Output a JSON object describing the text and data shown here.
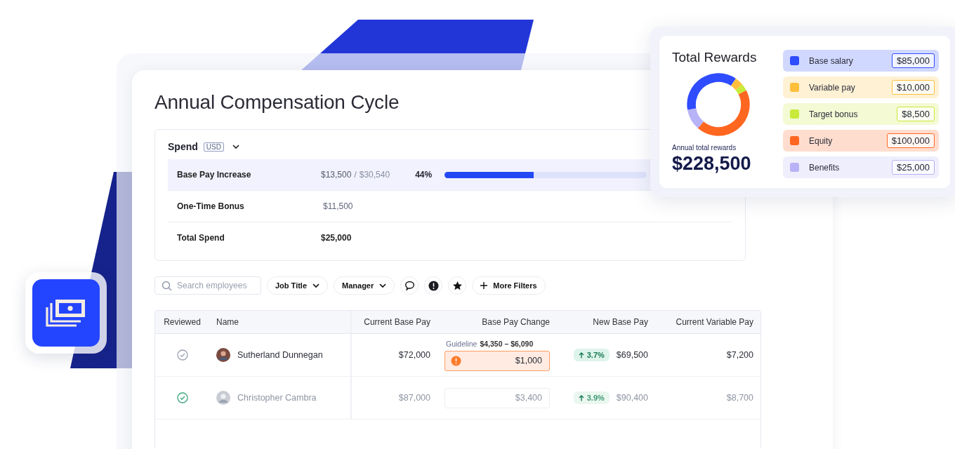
{
  "title": "Annual Compensation Cycle",
  "spend": {
    "title": "Spend",
    "currency": "USD",
    "rows": [
      {
        "kind": "progress",
        "label": "Base Pay Increase",
        "amount": "$13,500",
        "separator": "/",
        "budget": "$30,540",
        "percent": "44%",
        "level": 0.44,
        "selected": true
      },
      {
        "kind": "plain",
        "label": "One-Time Bonus",
        "amount": "$11,500",
        "selected": false
      },
      {
        "kind": "total",
        "label": "Total Spend",
        "amount": "$25,000",
        "selected": false
      }
    ]
  },
  "filters": {
    "search": {
      "placeholder": "Search employees"
    },
    "items": [
      {
        "kind": "dropdown",
        "label": "Job Title"
      },
      {
        "kind": "dropdown",
        "label": "Manager"
      },
      {
        "kind": "comment"
      },
      {
        "kind": "alert"
      },
      {
        "kind": "star"
      },
      {
        "kind": "add",
        "label": "More Filters"
      }
    ]
  },
  "table": {
    "columns": [
      "Reviewed",
      "Name",
      "Current Base Pay",
      "Base Pay Change",
      "New Base Pay",
      "Current Variable Pay"
    ],
    "rows": [
      {
        "reviewed": false,
        "name": "Sutherland Dunnegan",
        "current_base_pay": "$72,000",
        "guideline_label": "Guideline",
        "guideline_range": "$4,350 – $6,090",
        "change": "$1,000",
        "warning": true,
        "change_percent": "3.7%",
        "new_base_pay": "$69,500",
        "current_variable_pay": "$7,200"
      },
      {
        "reviewed": true,
        "name": "Christopher Cambra",
        "current_base_pay": "$87,000",
        "change": "$3,400",
        "warning": false,
        "change_percent": "3.9%",
        "new_base_pay": "$90,400",
        "current_variable_pay": "$8,700"
      }
    ]
  },
  "total_rewards": {
    "title": "Total Rewards",
    "caption": "Annual total rewards",
    "total": "$228,500",
    "items": [
      {
        "label": "Base salary",
        "amount": "$85,000",
        "color": "#2f4cff"
      },
      {
        "label": "Variable pay",
        "amount": "$10,000",
        "color": "#ffbf3c"
      },
      {
        "label": "Target bonus",
        "amount": "$8,500",
        "color": "#c9ea3a"
      },
      {
        "label": "Equity",
        "amount": "$100,000",
        "color": "#ff6620"
      },
      {
        "label": "Benefits",
        "amount": "$25,000",
        "color": "#b8b3f7"
      }
    ]
  }
}
